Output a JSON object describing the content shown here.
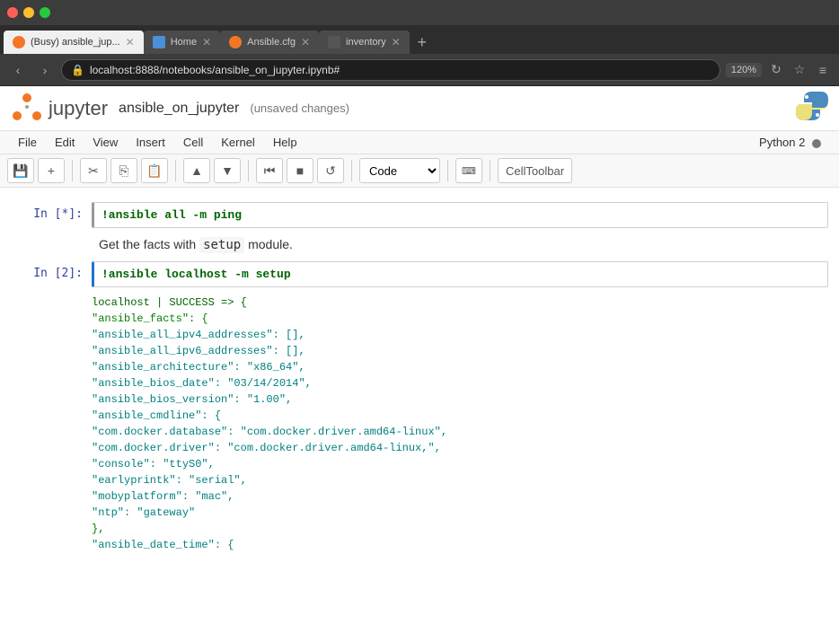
{
  "browser": {
    "title_bar": {
      "traffic_lights": [
        "red",
        "yellow",
        "green"
      ]
    },
    "tabs": [
      {
        "id": "jupyter-tab",
        "label": "(Busy) ansible_jup...",
        "active": true,
        "favicon": "jupyter",
        "closable": true
      },
      {
        "id": "home-tab",
        "label": "Home",
        "active": false,
        "favicon": "home",
        "closable": true
      },
      {
        "id": "ansiblecfg-tab",
        "label": "Ansible.cfg",
        "active": false,
        "favicon": "jupyter",
        "closable": true
      },
      {
        "id": "inventory-tab",
        "label": "inventory",
        "active": false,
        "favicon": "file",
        "closable": true
      }
    ],
    "add_tab_label": "+",
    "address_bar": {
      "url": "localhost:8888/notebooks/ansible_on_jupyter.ipynb#",
      "zoom": "120%"
    }
  },
  "jupyter": {
    "logo_text": "jupyter",
    "notebook_title": "ansible_on_jupyter",
    "unsaved_label": "(unsaved changes)",
    "kernel_label": "Python 2",
    "menu": {
      "items": [
        "File",
        "Edit",
        "View",
        "Insert",
        "Cell",
        "Kernel",
        "Help"
      ]
    },
    "toolbar": {
      "cell_type": "Code",
      "cell_toolbar_label": "CellToolbar"
    },
    "cells": [
      {
        "type": "code",
        "prompt": "In [*]:",
        "running": true,
        "content": "!ansible all -m ping"
      },
      {
        "type": "text",
        "content": "Get the facts with setup module."
      },
      {
        "type": "code",
        "prompt": "In [2]:",
        "running": false,
        "content": "!ansible localhost -m setup"
      }
    ],
    "output": {
      "prompt": "",
      "lines": [
        {
          "text": "localhost | SUCCESS => {",
          "color": "green"
        },
        {
          "text": "    \"ansible_facts\": {",
          "color": "darkgreen"
        },
        {
          "text": "        \"ansible_all_ipv4_addresses\": [],",
          "color": "teal"
        },
        {
          "text": "        \"ansible_all_ipv6_addresses\": [],",
          "color": "teal"
        },
        {
          "text": "        \"ansible_architecture\": \"x86_64\",",
          "color": "teal"
        },
        {
          "text": "        \"ansible_bios_date\": \"03/14/2014\",",
          "color": "teal"
        },
        {
          "text": "        \"ansible_bios_version\": \"1.00\",",
          "color": "teal"
        },
        {
          "text": "        \"ansible_cmdline\": {",
          "color": "teal"
        },
        {
          "text": "            \"com.docker.database\": \"com.docker.driver.amd64-linux\",",
          "color": "teal"
        },
        {
          "text": "            \"com.docker.driver\": \"com.docker.driver.amd64-linux,\",",
          "color": "teal"
        },
        {
          "text": "            \"console\": \"ttyS0\",",
          "color": "teal"
        },
        {
          "text": "            \"earlyprintk\": \"serial\",",
          "color": "teal"
        },
        {
          "text": "            \"mobyplatform\": \"mac\",",
          "color": "teal"
        },
        {
          "text": "            \"ntp\": \"gateway\"",
          "color": "teal"
        },
        {
          "text": "        },",
          "color": "darkgreen"
        },
        {
          "text": "        \"ansible_date_time\": {",
          "color": "teal"
        }
      ]
    }
  }
}
